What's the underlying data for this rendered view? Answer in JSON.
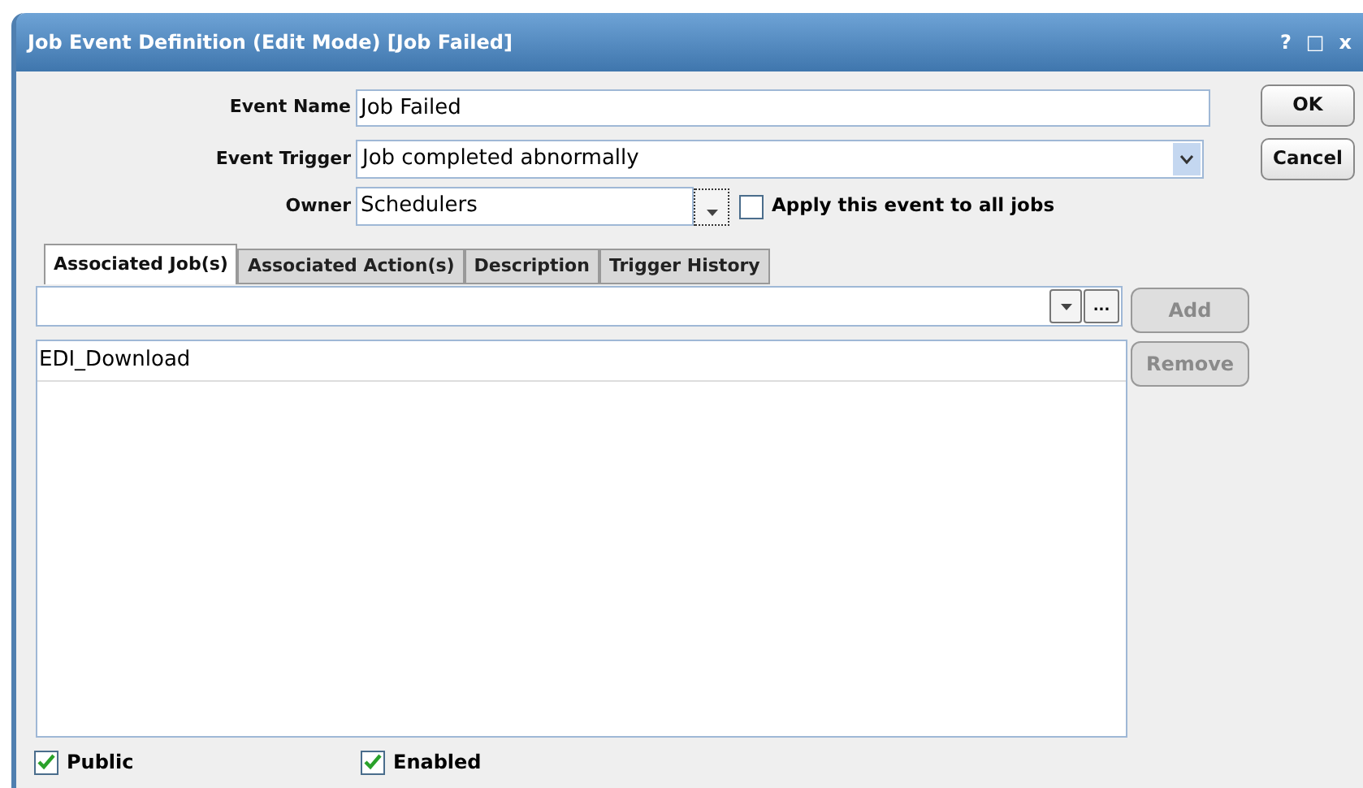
{
  "window": {
    "title": "Job Event Definition (Edit Mode) [Job Failed]",
    "controls": [
      "?",
      "□",
      "x"
    ]
  },
  "form": {
    "event_name": {
      "label": "Event Name",
      "value": "Job Failed"
    },
    "event_trigger": {
      "label": "Event Trigger",
      "value": "Job completed abnormally"
    },
    "owner": {
      "label": "Owner",
      "value": "Schedulers"
    },
    "apply_all": {
      "label": "Apply this event to all jobs",
      "checked": false
    }
  },
  "buttons": [
    {
      "label": "OK",
      "disabled": false
    },
    {
      "label": "Cancel",
      "disabled": false
    }
  ],
  "tabs": [
    {
      "label": "Associated Job(s)",
      "selected": true
    },
    {
      "label": "Associated Action(s)",
      "selected": false
    },
    {
      "label": "Description",
      "selected": false
    },
    {
      "label": "Trigger History",
      "selected": false
    }
  ],
  "jobs_panel": {
    "browse_label": "...",
    "add": {
      "label": "Add",
      "disabled": true
    },
    "remove": {
      "label": "Remove",
      "disabled": true
    },
    "items": [
      {
        "label": "EDI_Download"
      }
    ]
  },
  "footer": [
    {
      "label": "Public",
      "checked": true
    },
    {
      "label": "Enabled",
      "checked": true
    }
  ]
}
